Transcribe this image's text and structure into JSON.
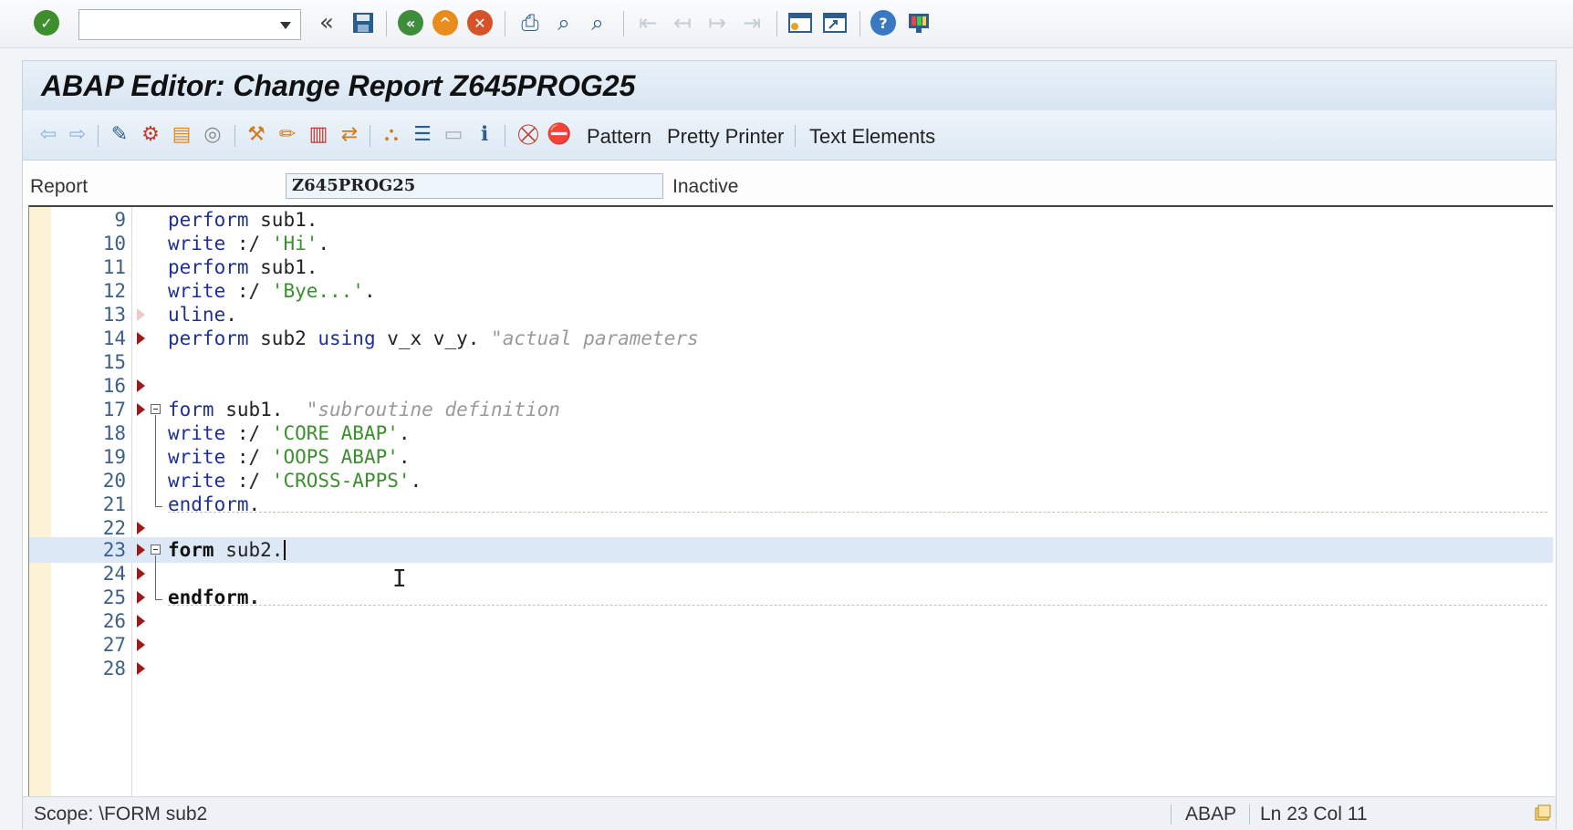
{
  "system_toolbar": {
    "command_field": "",
    "icons": [
      "enter-check-icon",
      "command-field-dropdown-icon",
      "collapse-icon",
      "save-icon",
      "back-icon",
      "exit-icon",
      "cancel-icon",
      "print-icon",
      "find-icon",
      "find-next-icon",
      "first-page-icon",
      "previous-page-icon",
      "next-page-icon",
      "last-page-icon",
      "create-session-icon",
      "shortcut-icon",
      "help-icon",
      "customize-layout-icon"
    ]
  },
  "window": {
    "title": "ABAP Editor: Change Report Z645PROG25"
  },
  "app_toolbar": {
    "pattern_label": "Pattern",
    "pretty_printer_label": "Pretty Printer",
    "text_elements_label": "Text Elements"
  },
  "report": {
    "label": "Report",
    "name": "Z645PROG25",
    "status": "Inactive"
  },
  "editor": {
    "lines": [
      {
        "num": "9"
      },
      {
        "num": "10"
      },
      {
        "num": "11"
      },
      {
        "num": "12"
      },
      {
        "num": "13"
      },
      {
        "num": "14"
      },
      {
        "num": "15"
      },
      {
        "num": "16"
      },
      {
        "num": "17"
      },
      {
        "num": "18"
      },
      {
        "num": "19"
      },
      {
        "num": "20"
      },
      {
        "num": "21"
      },
      {
        "num": "22"
      },
      {
        "num": "23"
      },
      {
        "num": "24"
      },
      {
        "num": "25"
      },
      {
        "num": "26"
      },
      {
        "num": "27"
      },
      {
        "num": "28"
      }
    ],
    "tokens": {
      "l9": [
        "perform",
        " sub1",
        "."
      ],
      "l10": [
        "write",
        " :/ ",
        "'Hi'",
        "."
      ],
      "l11": [
        "perform",
        " sub1",
        "."
      ],
      "l12": [
        "write",
        " :/ ",
        "'Bye...'",
        "."
      ],
      "l13": [
        "uline",
        "."
      ],
      "l14": [
        "perform",
        " sub2 ",
        "using",
        " v_x v_y",
        ". ",
        "\"actual parameters"
      ],
      "l17": [
        "form",
        " sub1",
        ".  ",
        "\"subroutine definition"
      ],
      "l18": [
        "write",
        " :/ ",
        "'CORE ABAP'",
        "."
      ],
      "l19": [
        "write",
        " :/ ",
        "'OOPS ABAP'",
        "."
      ],
      "l20": [
        "write",
        " :/ ",
        "'CROSS-APPS'",
        "."
      ],
      "l21": [
        "endform",
        "."
      ],
      "l23": [
        "form",
        " sub2",
        "."
      ],
      "l25": [
        "endform",
        "."
      ]
    }
  },
  "status_bar": {
    "scope": "Scope: \\FORM sub2",
    "language": "ABAP",
    "position": "Ln  23 Col  11"
  },
  "colors": {
    "keyword": "#1e2f9b",
    "string": "#3b8f2f",
    "comment": "#9a9a9a",
    "line_number": "#3b5f87",
    "breakpoint_marker": "#9b1b1b"
  }
}
